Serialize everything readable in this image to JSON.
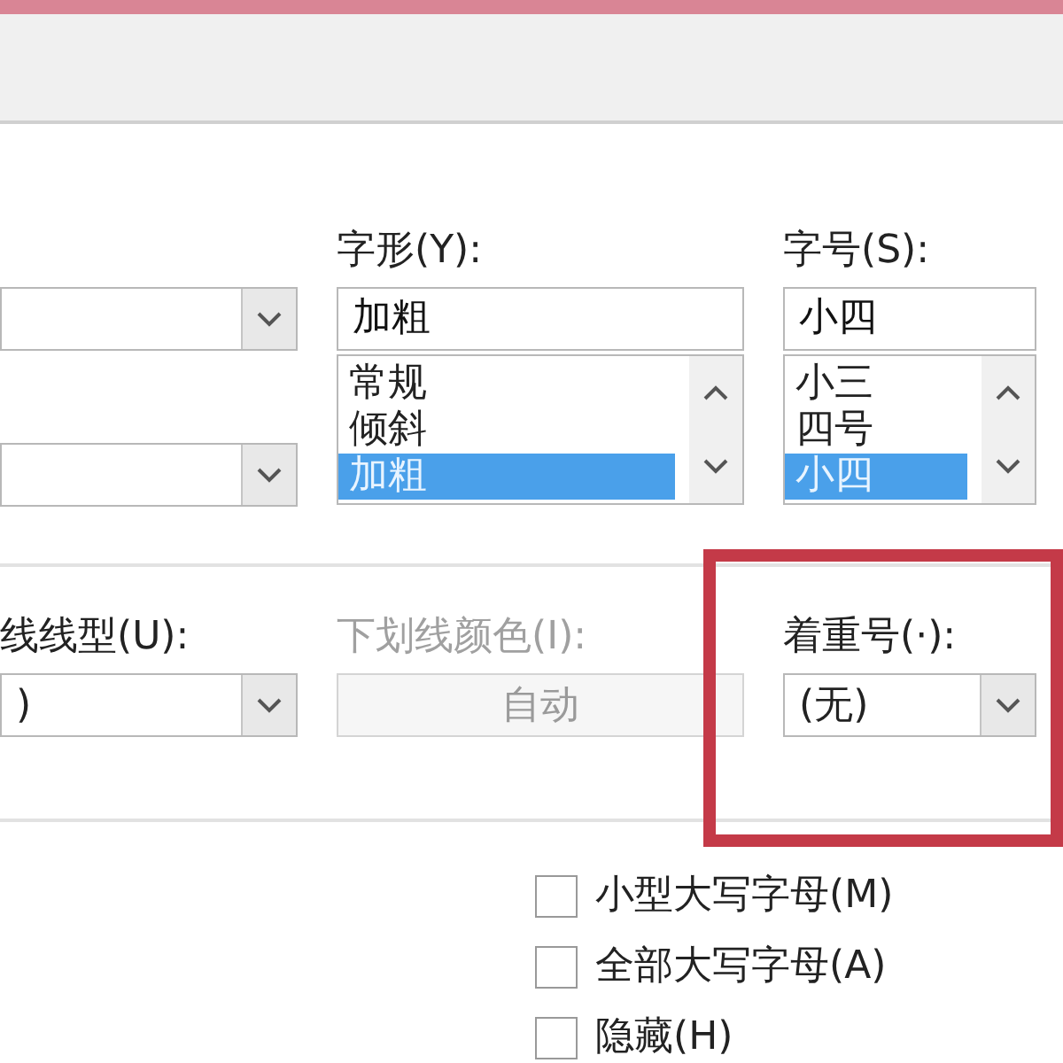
{
  "font_row": {
    "left_dropdowns": [
      {
        "kind": "dropdown"
      },
      {
        "kind": "dropdown"
      }
    ],
    "style": {
      "label": "字形(Y):",
      "value": "加粗",
      "options": [
        {
          "label": "常规",
          "selected": false
        },
        {
          "label": "倾斜",
          "selected": false
        },
        {
          "label": "加粗",
          "selected": true
        }
      ]
    },
    "size": {
      "label": "字号(S):",
      "value": "小四",
      "options": [
        {
          "label": "小三",
          "selected": false
        },
        {
          "label": "四号",
          "selected": false
        },
        {
          "label": "小四",
          "selected": true
        }
      ]
    }
  },
  "underline_row": [
    {
      "label": "线线型(U):",
      "value": ")",
      "disabled": false,
      "highlighted": false
    },
    {
      "label": "下划线颜色(I):",
      "value": "自动",
      "disabled": true,
      "highlighted": false
    },
    {
      "label": "着重号(·):",
      "value": "(无)",
      "disabled": false,
      "highlighted": true
    }
  ],
  "effects": [
    {
      "label": "小型大写字母(M)",
      "checked": false
    },
    {
      "label": "全部大写字母(A)",
      "checked": false
    },
    {
      "label": "隐藏(H)",
      "checked": false
    }
  ]
}
